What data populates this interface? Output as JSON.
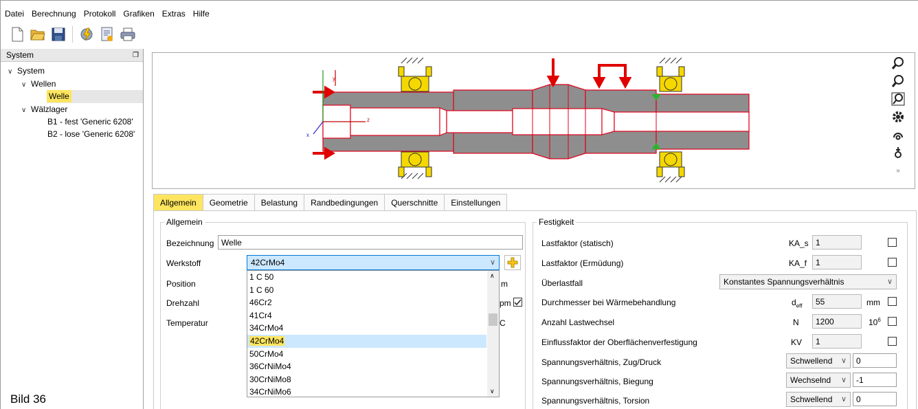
{
  "menu": {
    "items": [
      "Datei",
      "Berechnung",
      "Protokoll",
      "Grafiken",
      "Extras",
      "Hilfe"
    ]
  },
  "left": {
    "title": "System",
    "tree": {
      "system": "System",
      "wellen": "Wellen",
      "welle": "Welle",
      "waelzlager": "Wälzlager",
      "b1": "B1 - fest 'Generic 6208'",
      "b2": "B2 - lose 'Generic 6208'"
    },
    "caption": "Bild 36"
  },
  "tabs": [
    "Allgemein",
    "Geometrie",
    "Belastung",
    "Randbedingungen",
    "Querschnitte",
    "Einstellungen"
  ],
  "allgemein": {
    "legend": "Allgemein",
    "bezeichnung_label": "Bezeichnung",
    "bezeichnung_value": "Welle",
    "werkstoff_label": "Werkstoff",
    "werkstoff_value": "42CrMo4",
    "position_label": "Position",
    "drehzahl_label": "Drehzahl",
    "temperatur_label": "Temperatur",
    "pos_unit_tail": "m",
    "dreh_unit_tail": "pm",
    "temp_unit_tail": "C"
  },
  "dropdown": {
    "options": [
      "1 C 50",
      "1 C 60",
      "46Cr2",
      "41Cr4",
      "34CrMo4",
      "42CrMo4",
      "50CrMo4",
      "36CrNiMo4",
      "30CrNiMo8",
      "34CrNiMo6"
    ],
    "selected": "42CrMo4"
  },
  "festigkeit": {
    "legend": "Festigkeit",
    "rows": [
      {
        "label": "Lastfaktor (statisch)",
        "sym": "KA_s",
        "value": "1",
        "unit": ""
      },
      {
        "label": "Lastfaktor (Ermüdung)",
        "sym": "KA_f",
        "value": "1",
        "unit": ""
      },
      {
        "label": "Überlastfall",
        "select": "Konstantes Spannungsverhältnis"
      },
      {
        "label": "Durchmesser bei Wärmebehandlung",
        "sym": "d",
        "sym_sub": "eff",
        "value": "55",
        "unit": "mm"
      },
      {
        "label": "Anzahl Lastwechsel",
        "sym": "N",
        "value": "1200",
        "unit": "10",
        "unit_sup": "6"
      },
      {
        "label": "Einflussfaktor der Oberflächenverfestigung",
        "sym": "KV",
        "value": "1",
        "unit": ""
      },
      {
        "label": "Spannungsverhältnis, Zug/Druck",
        "select": "Schwellend",
        "value": "0"
      },
      {
        "label": "Spannungsverhältnis, Biegung",
        "select": "Wechselnd",
        "value": "-1"
      },
      {
        "label": "Spannungsverhältnis, Torsion",
        "select": "Schwellend",
        "value": "0"
      }
    ]
  },
  "view": {
    "axis_y": "y",
    "axis_z": "z",
    "axis_x": "x",
    "expand": "»"
  },
  "colors": {
    "highlight": "#fde55f",
    "selection": "#cce8ff",
    "shaft": "#8e8e8e",
    "outline": "#e0001b",
    "bearing": "#f5d800",
    "arrow": "#e00000"
  }
}
